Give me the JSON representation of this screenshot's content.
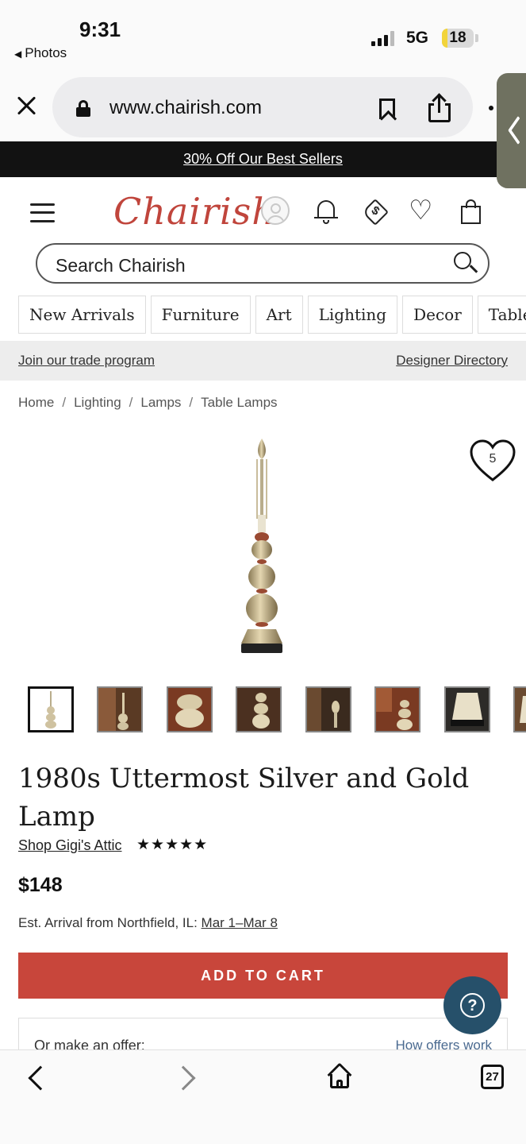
{
  "status_bar": {
    "time": "9:31",
    "back_app": "Photos",
    "network": "5G",
    "battery": "18",
    "battery_level": 0.18
  },
  "browser": {
    "url": "www.chairish.com",
    "tab_count": "27"
  },
  "promo": {
    "text": "30% Off Our Best Sellers"
  },
  "header": {
    "logo": "Chairish",
    "search_placeholder": "Search Chairish"
  },
  "nav": {
    "categories": [
      "New Arrivals",
      "Furniture",
      "Art",
      "Lighting",
      "Decor",
      "Tabletop"
    ]
  },
  "trade": {
    "left_link": "Join our trade program",
    "right_link": "Designer Directory"
  },
  "breadcrumb": [
    "Home",
    "Lighting",
    "Lamps",
    "Table Lamps"
  ],
  "product": {
    "favorites_count": "5",
    "thumbnail_count": 8,
    "title": "1980s Uttermost Silver and Gold Lamp",
    "shop": "Shop Gigi's Attic",
    "rating": "★★★★★",
    "price": "$148",
    "arrival_prefix": "Est. Arrival from Northfield, IL:",
    "arrival_dates": "Mar 1–Mar 8",
    "add_to_cart": "ADD TO CART",
    "offer_label": "Or make an offer:",
    "offer_link": "How offers work"
  },
  "colors": {
    "brand_red": "#c8463b",
    "help_blue": "#26506a",
    "promo_bg": "#121212"
  }
}
